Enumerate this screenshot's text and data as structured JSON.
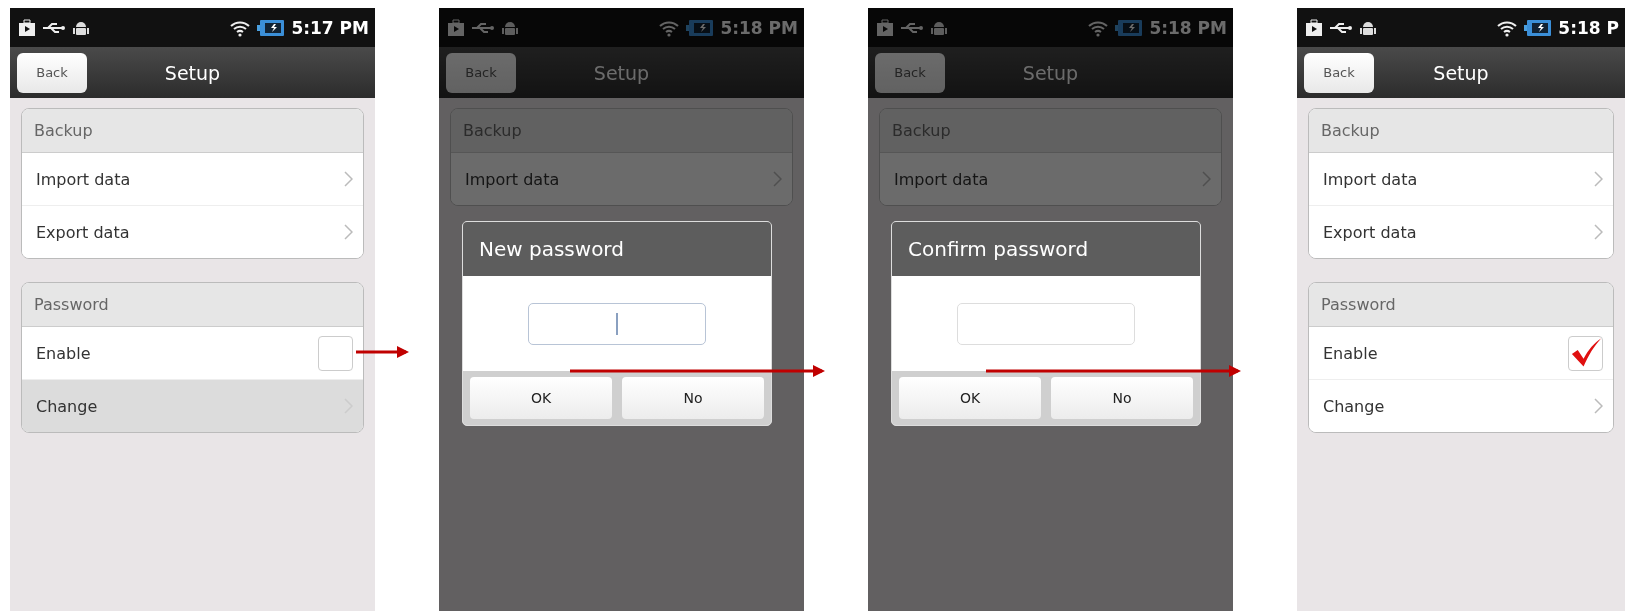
{
  "screens": [
    {
      "time": "5:17 PM",
      "back": "Back",
      "title": "Setup",
      "dimmed": false,
      "sections": [
        {
          "header": "Backup",
          "rows": [
            {
              "kind": "link",
              "label": "Import data",
              "pressed": false
            },
            {
              "kind": "link",
              "label": "Export data",
              "pressed": false
            }
          ]
        },
        {
          "header": "Password",
          "rows": [
            {
              "kind": "checkbox",
              "label": "Enable",
              "checked": false
            },
            {
              "kind": "link",
              "label": "Change",
              "pressed": true
            }
          ]
        }
      ]
    },
    {
      "time": "5:18 PM",
      "back": "Back",
      "title": "Setup",
      "dimmed": true,
      "sections": [
        {
          "header": "Backup",
          "rows": [
            {
              "kind": "link",
              "label": "Import data",
              "pressed": false
            }
          ]
        }
      ],
      "dialog": {
        "title": "New password",
        "cursor": true,
        "buttons": [
          "OK",
          "No"
        ]
      }
    },
    {
      "time": "5:18 PM",
      "back": "Back",
      "title": "Setup",
      "dimmed": true,
      "sections": [
        {
          "header": "Backup",
          "rows": [
            {
              "kind": "link",
              "label": "Import data",
              "pressed": false
            }
          ]
        }
      ],
      "dialog": {
        "title": "Confirm password",
        "cursor": false,
        "buttons": [
          "OK",
          "No"
        ]
      }
    },
    {
      "time": "5:18 P",
      "back": "Back",
      "title": "Setup",
      "dimmed": false,
      "sections": [
        {
          "header": "Backup",
          "rows": [
            {
              "kind": "link",
              "label": "Import data",
              "pressed": false
            },
            {
              "kind": "link",
              "label": "Export data",
              "pressed": false
            }
          ]
        },
        {
          "header": "Password",
          "rows": [
            {
              "kind": "checkbox",
              "label": "Enable",
              "checked": true
            },
            {
              "kind": "link",
              "label": "Change",
              "pressed": false
            }
          ]
        }
      ]
    }
  ]
}
